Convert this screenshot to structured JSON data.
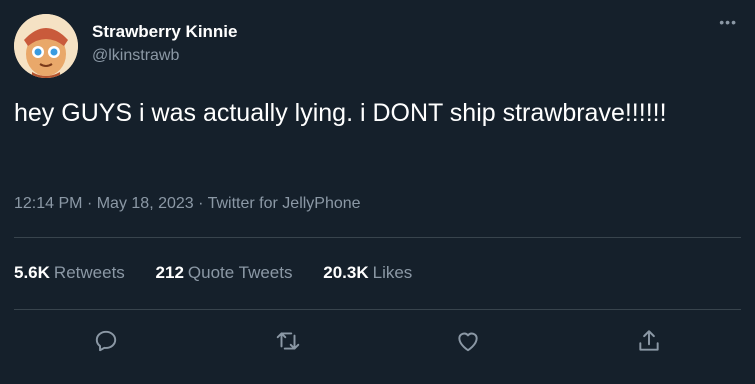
{
  "user": {
    "display_name": "Strawberry Kinnie",
    "handle": "@lkinstrawb",
    "avatar_icon": "cookie-character-avatar"
  },
  "more_icon": "more-horizontal-icon",
  "tweet": {
    "text": "hey GUYS i was actually lying. i DONT ship strawbrave!!!!!!",
    "time": "12:14 PM",
    "date": "May 18, 2023",
    "source": "Twitter for JellyPhone"
  },
  "stats": {
    "retweets_count": "5.6K",
    "retweets_label": "Retweets",
    "quotes_count": "212",
    "quotes_label": "Quote Tweets",
    "likes_count": "20.3K",
    "likes_label": "Likes"
  },
  "actions": {
    "reply_icon": "reply-icon",
    "retweet_icon": "retweet-icon",
    "like_icon": "heart-icon",
    "share_icon": "share-icon"
  },
  "colors": {
    "background": "#15202b",
    "text_primary": "#ffffff",
    "text_secondary": "#8b98a5",
    "divider": "#38444d"
  }
}
